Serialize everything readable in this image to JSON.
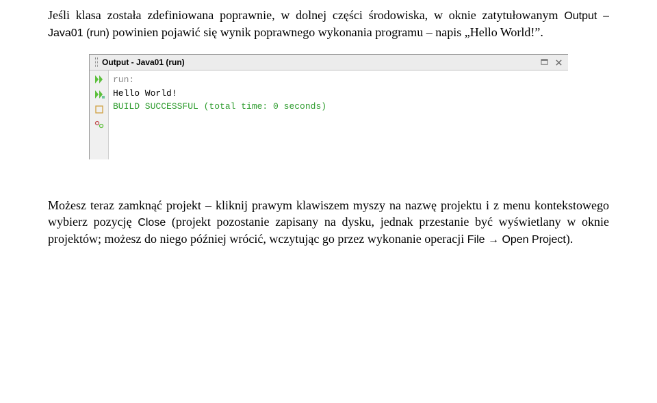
{
  "para1_prefix": "Jeśli klasa została zdefiniowana poprawnie, w dolnej części środowiska, w oknie zatytułowanym ",
  "para1_mono1": "Output – Java01 (run)",
  "para1_middle": " powinien pojawić się wynik poprawnego wykonania programu – napis „Hello World!”.",
  "panel": {
    "title": "Output - Java01 (run)",
    "console": {
      "line1": "run:",
      "line2": "Hello World!",
      "line3": "BUILD SUCCESSFUL (total time: 0 seconds)"
    }
  },
  "para2_a": "Możesz teraz zamknąć projekt – kliknij prawym klawiszem myszy na nazwę projektu i z menu kontekstowego wybierz pozycję ",
  "para2_mono1": "Close",
  "para2_b": " (projekt pozostanie zapisany na dysku, jednak przestanie być wyświetlany w oknie projektów; możesz do niego później wrócić, wczytując go przez wykonanie operacji ",
  "para2_mono2": "File → Open Project",
  "para2_c": ")."
}
